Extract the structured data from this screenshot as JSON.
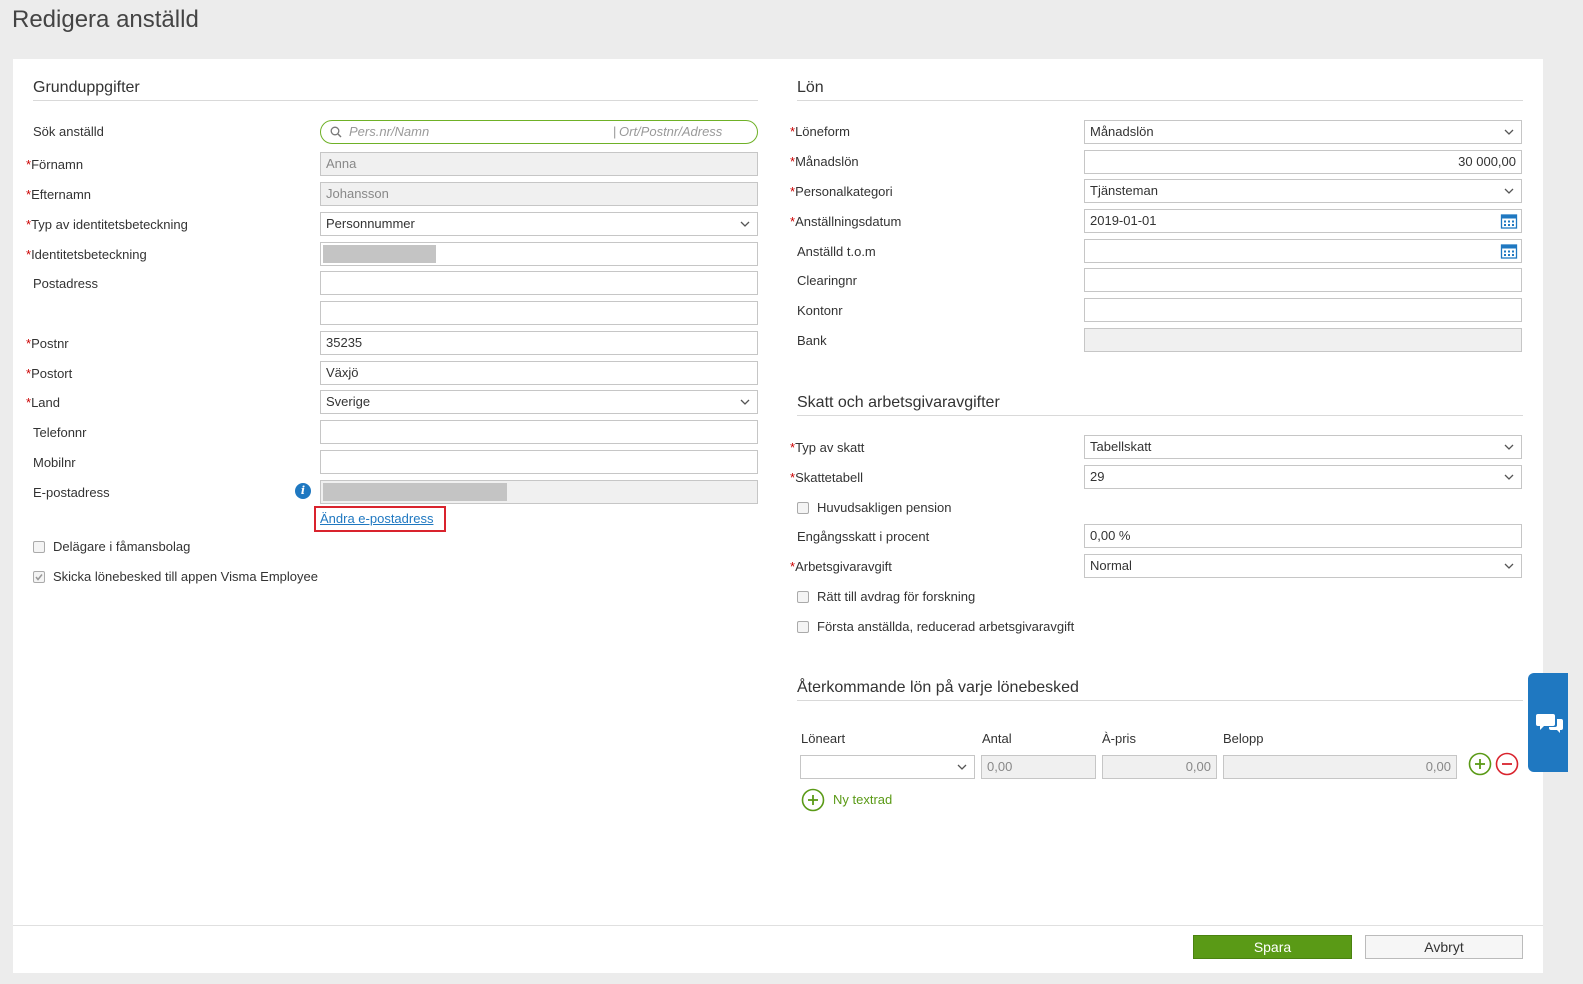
{
  "page": {
    "title": "Redigera anställd"
  },
  "left": {
    "section_title": "Grunduppgifter",
    "search_label": "Sök anställd",
    "search_placeholder_left": "Pers.nr/Namn",
    "search_placeholder_right": "Ort/Postnr/Adress",
    "fornamn_label": "Förnamn",
    "fornamn_value": "Anna",
    "efternamn_label": "Efternamn",
    "efternamn_value": "Johansson",
    "idtyp_label": "Typ av identitetsbeteckning",
    "idtyp_value": "Personnummer",
    "id_label": "Identitetsbeteckning",
    "postadress_label": "Postadress",
    "postnr_label": "Postnr",
    "postnr_value": "35235",
    "postort_label": "Postort",
    "postort_value": "Växjö",
    "land_label": "Land",
    "land_value": "Sverige",
    "telefon_label": "Telefonnr",
    "mobil_label": "Mobilnr",
    "epost_label": "E-postadress",
    "epost_link": "Ändra e-postadress",
    "delagare_label": "Delägare i fåmansbolag",
    "skicka_label": "Skicka lönebesked till appen Visma Employee"
  },
  "right": {
    "lon_title": "Lön",
    "loneform_label": "Löneform",
    "loneform_value": "Månadslön",
    "manadslon_label": "Månadslön",
    "manadslon_value": "30 000,00",
    "personalkategori_label": "Personalkategori",
    "personalkategori_value": "Tjänsteman",
    "anstallningsdatum_label": "Anställningsdatum",
    "anstallningsdatum_value": "2019-01-01",
    "anstalld_tom_label": "Anställd t.o.m",
    "clearing_label": "Clearingnr",
    "konto_label": "Kontonr",
    "bank_label": "Bank",
    "skatt_title": "Skatt och arbetsgivaravgifter",
    "typ_skatt_label": "Typ av skatt",
    "typ_skatt_value": "Tabellskatt",
    "skattetabell_label": "Skattetabell",
    "skattetabell_value": "29",
    "pension_label": "Huvudsakligen pension",
    "engang_label": "Engångsskatt i procent",
    "engang_value": "0,00 %",
    "arbetsgivaravgift_label": "Arbetsgivaravgift",
    "arbetsgivaravgift_value": "Normal",
    "forskning_label": "Rätt till avdrag för forskning",
    "forsta_label": "Första anställda, reducerad arbetsgivaravgift",
    "aterkommande_title": "Återkommande lön på varje lönebesked",
    "col_loneart": "Löneart",
    "col_antal": "Antal",
    "col_apris": "À-pris",
    "col_belopp": "Belopp",
    "row_antal": "0,00",
    "row_apris": "0,00",
    "row_belopp": "0,00",
    "ny_textrad": "Ny textrad"
  },
  "footer": {
    "save": "Spara",
    "cancel": "Avbryt"
  },
  "colors": {
    "accent_green": "#5a9a16",
    "link_blue": "#1f78c1",
    "required_red": "#c00000",
    "highlight_red": "#d9232d"
  },
  "icons": [
    "search-icon",
    "chevron-down-icon",
    "calendar-icon",
    "info-icon",
    "plus-circle-icon",
    "minus-circle-icon",
    "chat-icon"
  ]
}
